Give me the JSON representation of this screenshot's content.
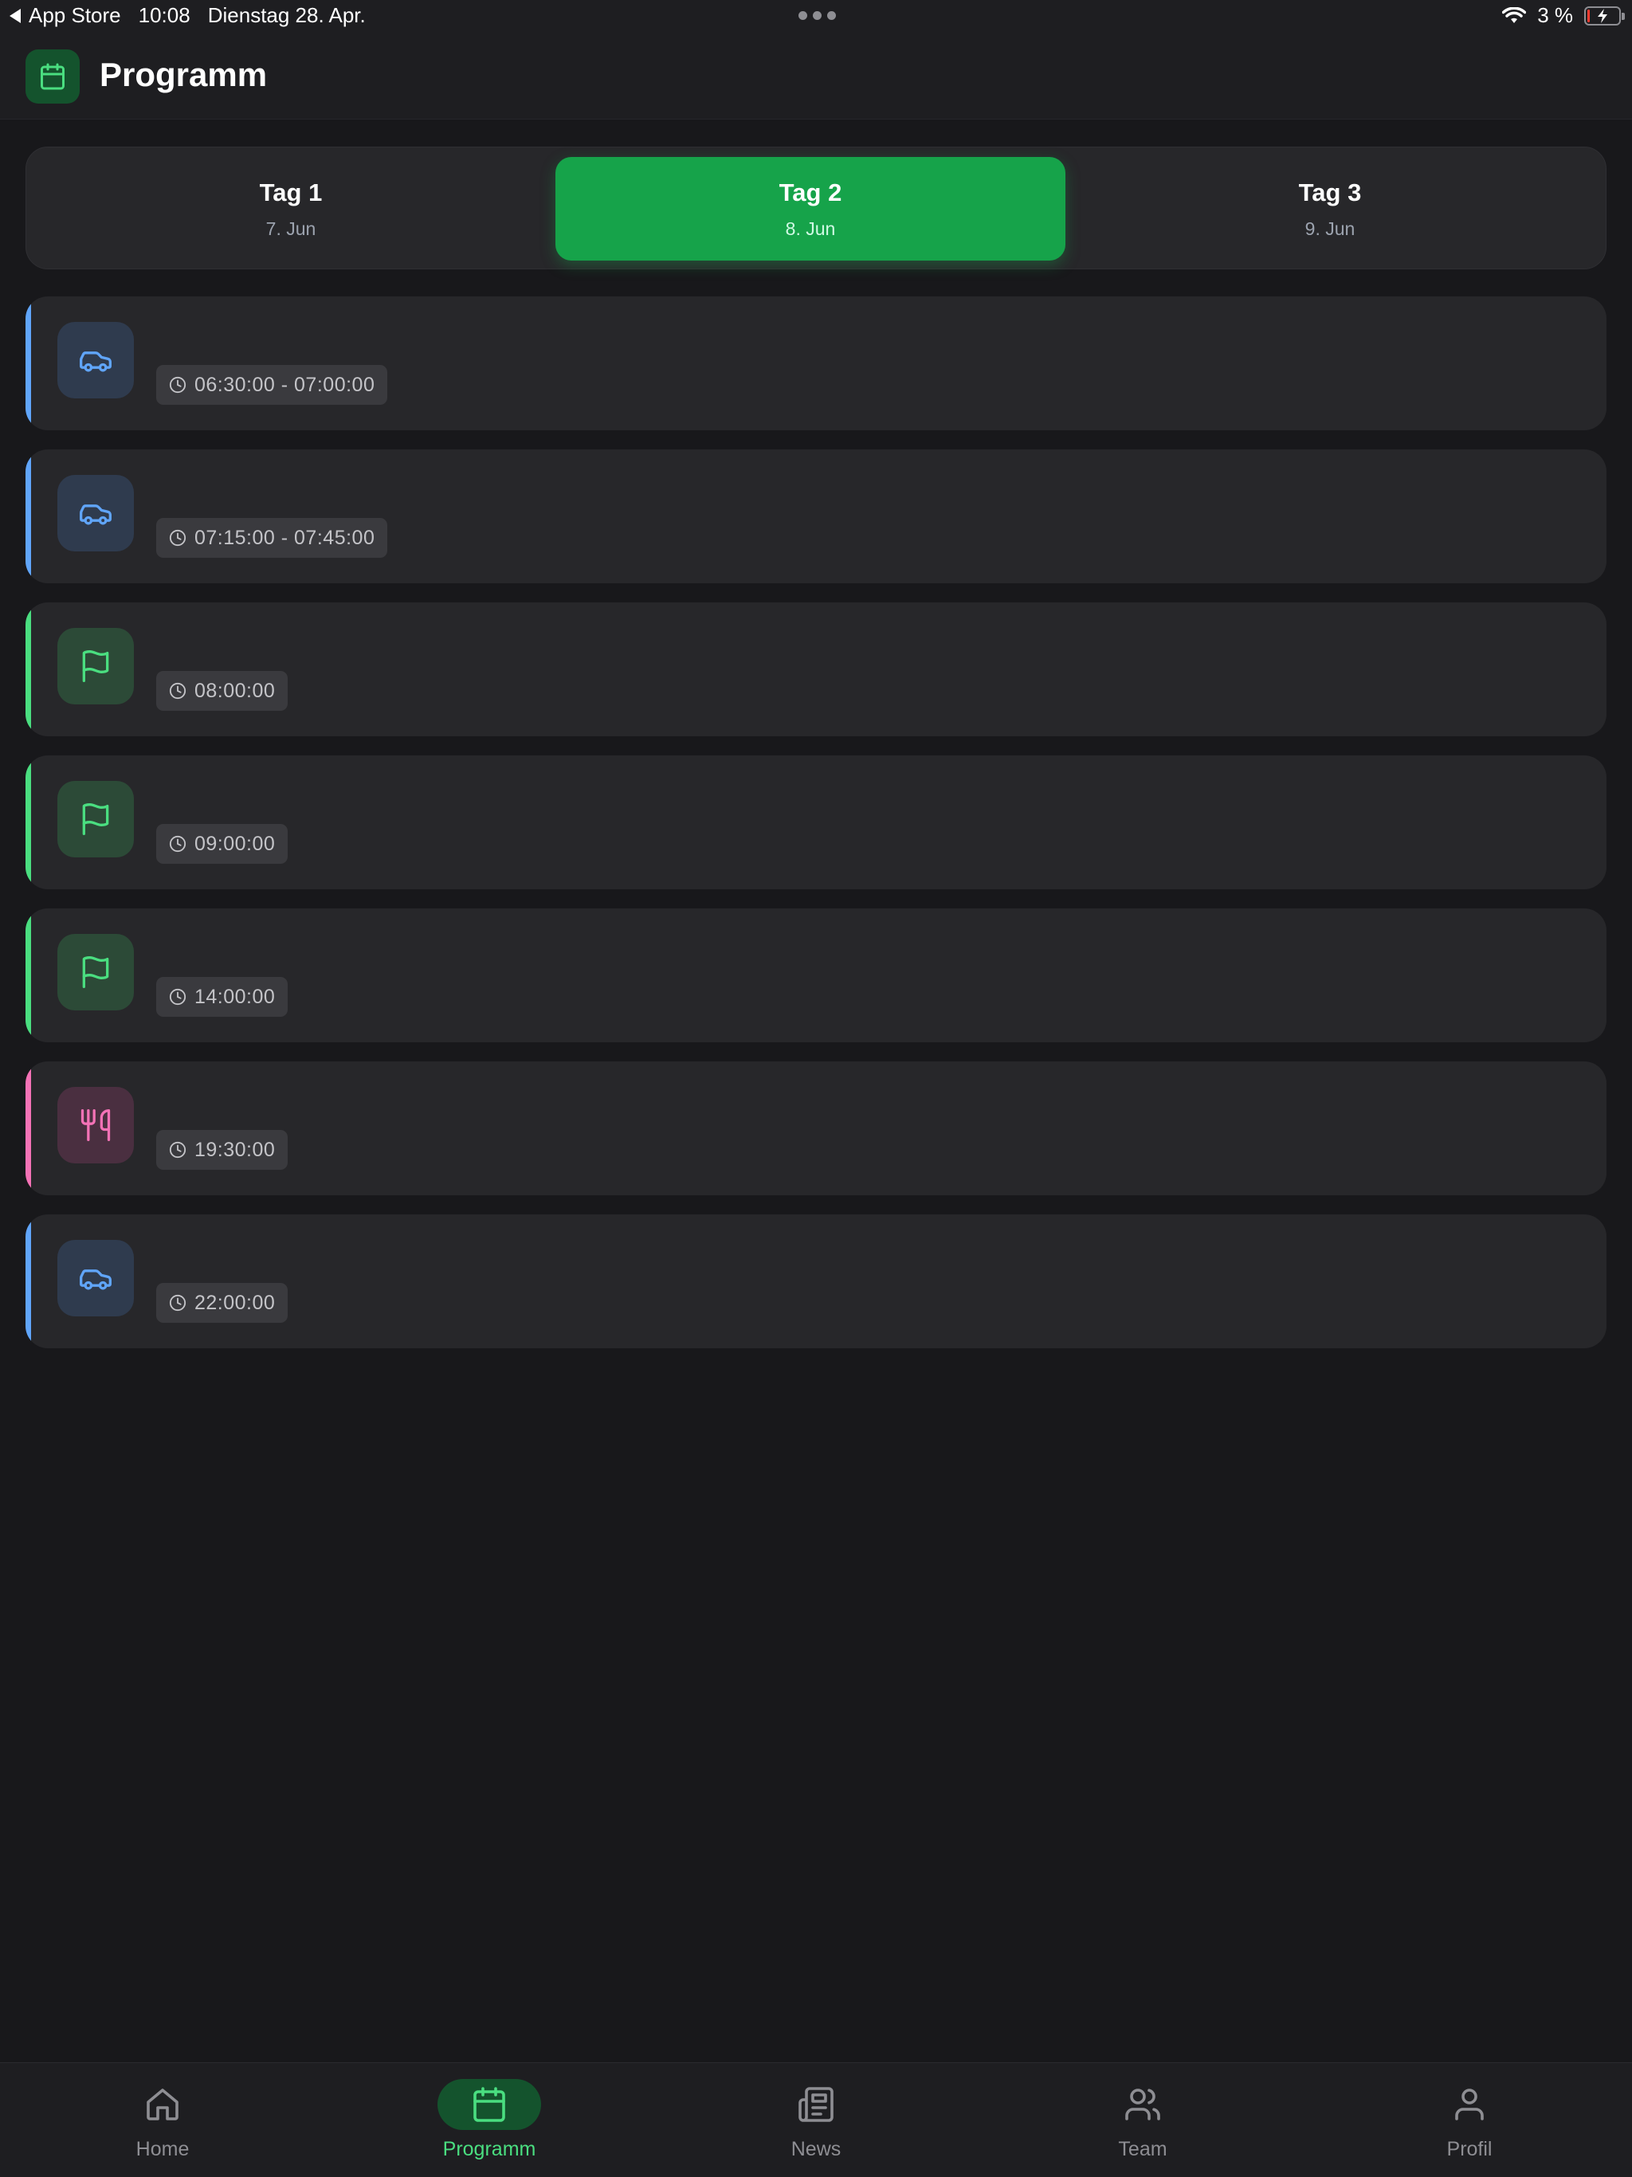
{
  "status_bar": {
    "back_label": "App Store",
    "time": "10:08",
    "date": "Dienstag 28. Apr.",
    "battery": "3 %"
  },
  "header": {
    "title": "Programm"
  },
  "days": [
    {
      "title": "Tag 1",
      "date": "7. Jun",
      "active": false
    },
    {
      "title": "Tag 2",
      "date": "8. Jun",
      "active": true
    },
    {
      "title": "Tag 3",
      "date": "9. Jun",
      "active": false
    }
  ],
  "events": [
    {
      "time": "06:30:00 - 07:00:00",
      "icon": "car-icon",
      "accent": "#60a5fa"
    },
    {
      "time": "07:15:00 - 07:45:00",
      "icon": "car-icon",
      "accent": "#60a5fa"
    },
    {
      "time": "08:00:00",
      "icon": "flag-icon",
      "accent": "#4ade80"
    },
    {
      "time": "09:00:00",
      "icon": "flag-icon",
      "accent": "#4ade80"
    },
    {
      "time": "14:00:00",
      "icon": "flag-icon",
      "accent": "#4ade80"
    },
    {
      "time": "19:30:00",
      "icon": "utensils-icon",
      "accent": "#f472b6"
    },
    {
      "time": "22:00:00",
      "icon": "car-icon",
      "accent": "#60a5fa"
    }
  ],
  "nav": [
    {
      "label": "Home",
      "icon": "home-icon",
      "active": false
    },
    {
      "label": "Programm",
      "icon": "calendar-icon",
      "active": true
    },
    {
      "label": "News",
      "icon": "newspaper-icon",
      "active": false
    },
    {
      "label": "Team",
      "icon": "users-icon",
      "active": false
    },
    {
      "label": "Profil",
      "icon": "user-icon",
      "active": false
    }
  ],
  "colors": {
    "accent_green": "#16a34a",
    "car_blue": "#60a5fa",
    "event_green": "#4ade80",
    "dining_pink": "#f472b6",
    "background": "#18181b",
    "card": "#27272a"
  }
}
